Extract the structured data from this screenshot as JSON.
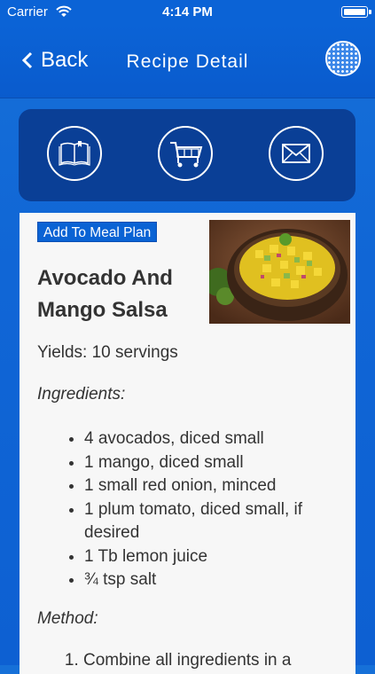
{
  "status_bar": {
    "carrier": "Carrier",
    "time": "4:14 PM"
  },
  "nav": {
    "back_label": "Back",
    "title": "Recipe Detail"
  },
  "actions": [
    {
      "icon": "book-icon"
    },
    {
      "icon": "shopping-cart-icon"
    },
    {
      "icon": "mail-icon"
    }
  ],
  "recipe": {
    "add_to_meal_plan_label": "Add To Meal Plan",
    "title": "Avocado And Mango Salsa",
    "yields": "Yields: 10 servings",
    "ingredients_heading": "Ingredients:",
    "ingredients": [
      "4 avocados, diced small",
      "1 mango, diced small",
      "1 small red onion, minced",
      "1 plum tomato, diced small, if desired",
      "1 Tb lemon juice",
      "¾ tsp salt"
    ],
    "method_heading": "Method:",
    "method": [
      "Combine all ingredients in a"
    ]
  },
  "colors": {
    "background": "#1066d6",
    "panel": "#0a3f96",
    "button": "#0a63d4"
  }
}
